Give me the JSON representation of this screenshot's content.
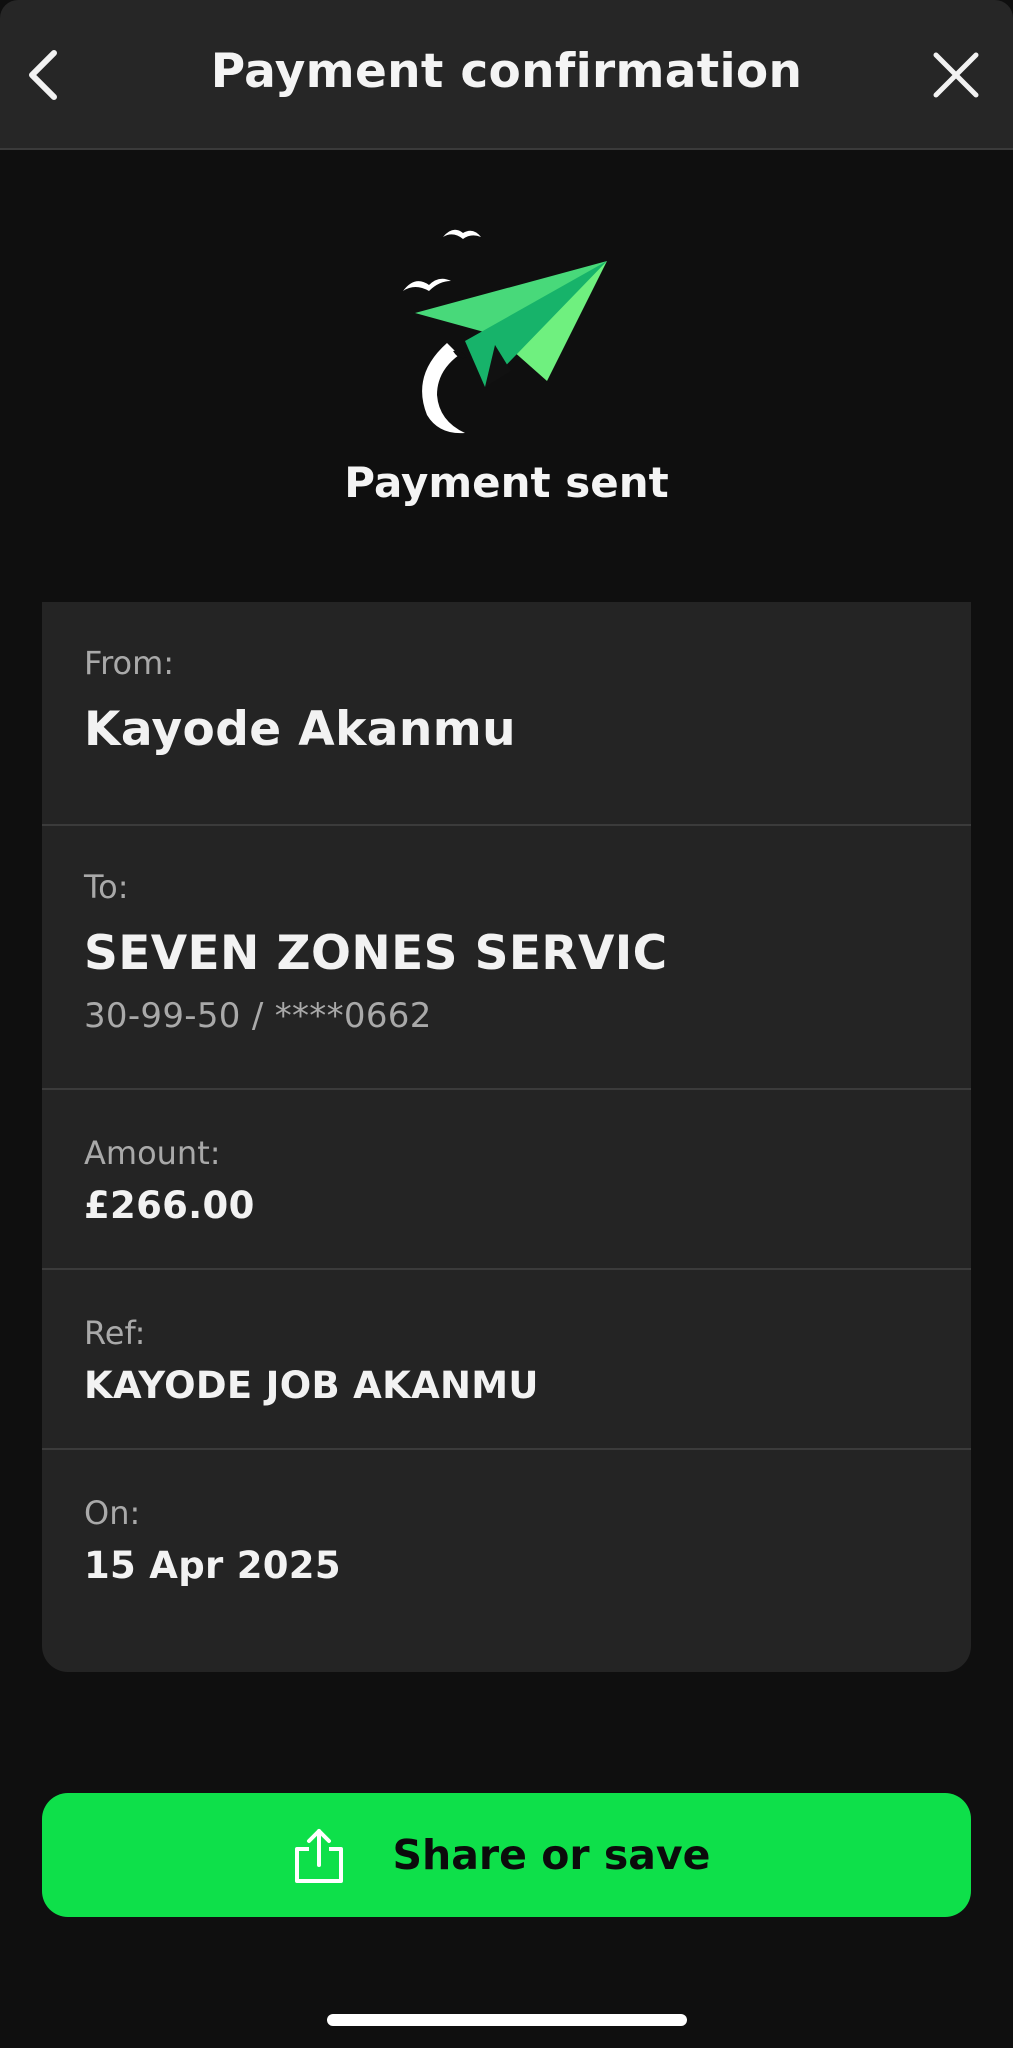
{
  "header": {
    "title": "Payment confirmation",
    "back_icon": "chevron-left-icon",
    "close_icon": "close-icon"
  },
  "hero": {
    "icon": "paper-plane-icon",
    "caption": "Payment sent"
  },
  "details": {
    "from": {
      "label": "From:",
      "value": "Kayode Akanmu"
    },
    "to": {
      "label": "To:",
      "value": "SEVEN ZONES SERVIC",
      "account": "30-99-50 / ****0662"
    },
    "amount": {
      "label": "Amount:",
      "value": "£266.00"
    },
    "ref": {
      "label": "Ref:",
      "value": "KAYODE JOB AKANMU"
    },
    "on": {
      "label": "On:",
      "value": "15 Apr 2025"
    }
  },
  "actions": {
    "share_label": "Share or save",
    "share_icon": "share-icon"
  },
  "colors": {
    "accent": "#0ee04a",
    "background": "#0f0f0f",
    "card": "#242424",
    "header": "#262626"
  }
}
